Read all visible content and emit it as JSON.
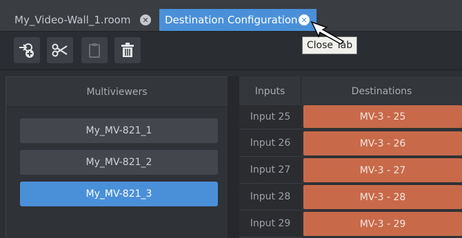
{
  "tabs": [
    {
      "label": "My_Video-Wall_1.room",
      "close_glyph": "✕"
    },
    {
      "label": "Destination Configuration",
      "close_glyph": "✕"
    }
  ],
  "toolbar": {
    "buttons": [
      {
        "icon": "add-input-icon",
        "enabled": true
      },
      {
        "icon": "scissors-icon",
        "enabled": true
      },
      {
        "icon": "clipboard-icon",
        "enabled": false
      },
      {
        "icon": "trash-icon",
        "enabled": true
      }
    ]
  },
  "tooltip": {
    "text": "Close Tab"
  },
  "multiviewers": {
    "header": "Multiviewers",
    "items": [
      {
        "label": "My_MV-821_1",
        "selected": false
      },
      {
        "label": "My_MV-821_2",
        "selected": false
      },
      {
        "label": "My_MV-821_3",
        "selected": true
      }
    ]
  },
  "table": {
    "headers": {
      "inputs": "Inputs",
      "destinations": "Destinations"
    },
    "rows": [
      {
        "input": "Input 25",
        "destination": "MV-3 - 25"
      },
      {
        "input": "Input 26",
        "destination": "MV-3 - 26"
      },
      {
        "input": "Input 27",
        "destination": "MV-3 - 27"
      },
      {
        "input": "Input 28",
        "destination": "MV-3 - 28"
      },
      {
        "input": "Input 29",
        "destination": "MV-3 - 29"
      }
    ]
  },
  "colors": {
    "accent": "#4a90d9",
    "destination": "#c86a4a",
    "background": "#2c2f33"
  }
}
